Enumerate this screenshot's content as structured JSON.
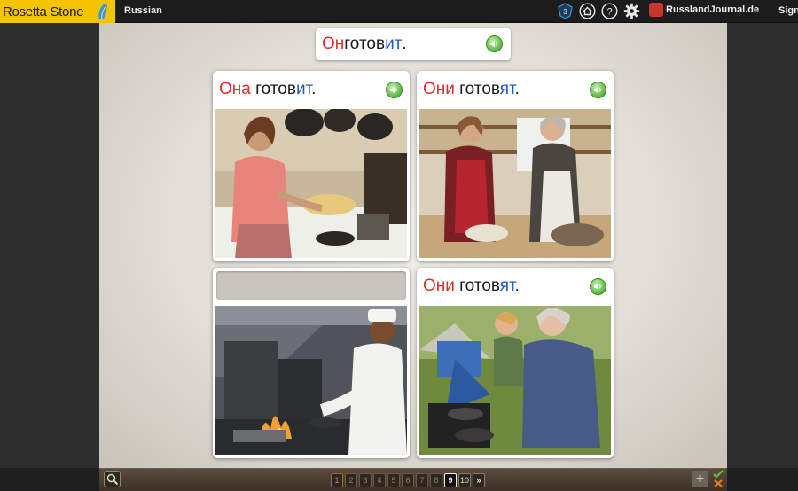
{
  "app": {
    "logo_text": "Rosetta Stone",
    "course": "Russian",
    "site_label": "RusslandJournal.de",
    "sign_label": "Sign"
  },
  "prompt": {
    "parts": [
      {
        "text": "Он",
        "color": "#d9302a"
      },
      {
        "text": " готов",
        "color": "#1a1a1a"
      },
      {
        "text": "ит",
        "color": "#1f5bc4"
      },
      {
        "text": ".",
        "color": "#1a1a1a"
      }
    ]
  },
  "cards": [
    {
      "caption": [
        {
          "text": "Она",
          "style": "red"
        },
        {
          "text": " готов",
          "style": "plain"
        },
        {
          "text": "ит",
          "style": "blue"
        },
        {
          "text": ".",
          "style": "plain"
        }
      ],
      "image": "woman-cooking-in-kitchen"
    },
    {
      "caption": [
        {
          "text": "Они",
          "style": "red"
        },
        {
          "text": " готов",
          "style": "plain"
        },
        {
          "text": "ят",
          "style": "blue"
        },
        {
          "text": ".",
          "style": "plain"
        }
      ],
      "image": "two-women-cooking"
    },
    {
      "caption": [],
      "image": "chef-at-flaming-stove"
    },
    {
      "caption": [
        {
          "text": "Они",
          "style": "red"
        },
        {
          "text": " готов",
          "style": "plain"
        },
        {
          "text": "ят",
          "style": "blue"
        },
        {
          "text": ".",
          "style": "plain"
        }
      ],
      "image": "grandmother-and-boy-camp-cooking"
    }
  ],
  "pager": {
    "pages": [
      "1",
      "2",
      "3",
      "4",
      "5",
      "6",
      "7",
      "8",
      "9",
      "10"
    ],
    "current": "9",
    "next_label": "»"
  },
  "colors": {
    "logo_bg": "#f5c400",
    "accent_red": "#d9302a",
    "accent_blue": "#1f5bc4",
    "speaker_green": "#6ec452"
  },
  "icons": [
    "profile-shield-icon",
    "home-icon",
    "help-icon",
    "gear-icon",
    "site-favicon-icon",
    "speaker-icon",
    "magnify-icon",
    "plus-icon",
    "check-icon",
    "x-icon"
  ]
}
